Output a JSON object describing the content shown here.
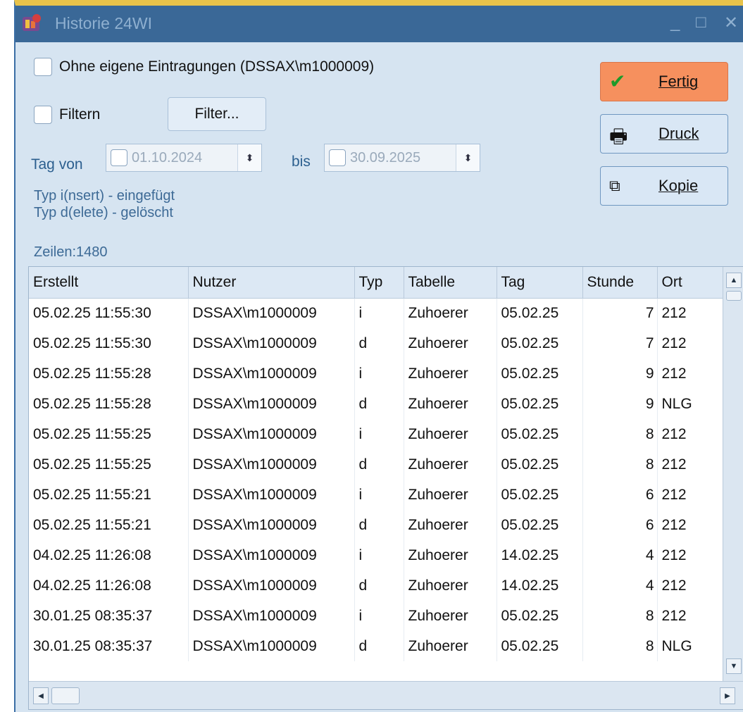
{
  "window": {
    "title": "Historie 24WI",
    "minimize": "_",
    "maximize": "□",
    "close": "✕"
  },
  "options": {
    "ohne_eigene_label": "Ohne eigene Eintragungen (DSSAX\\m1000009)",
    "filtern_label": "Filtern",
    "filter_button": "Filter..."
  },
  "date_range": {
    "von_label": "Tag von",
    "von_value": "01.10.2024",
    "bis_label": "bis",
    "bis_value": "30.09.2025"
  },
  "info": {
    "line1": "Typ i(nsert) - eingefügt",
    "line2": "Typ d(elete) - gelöscht",
    "rows": "Zeilen:1480"
  },
  "actions": {
    "fertig": "Fertig",
    "druck": "Druck",
    "kopie": "Kopie"
  },
  "icons": {
    "fertig": "check-icon",
    "druck": "printer-icon",
    "kopie": "copy-icon"
  },
  "colors": {
    "titlebar": "#3a6897",
    "primary_button": "#f6905e",
    "accent_text": "#2c5f8f"
  },
  "table": {
    "columns": [
      "Erstellt",
      "Nutzer",
      "Typ",
      "Tabelle",
      "Tag",
      "Stunde",
      "Ort"
    ],
    "rows": [
      [
        "05.02.25 11:55:30",
        "DSSAX\\m1000009",
        "i",
        "Zuhoerer",
        "05.02.25",
        "7",
        "212"
      ],
      [
        "05.02.25 11:55:30",
        "DSSAX\\m1000009",
        "d",
        "Zuhoerer",
        "05.02.25",
        "7",
        "212"
      ],
      [
        "05.02.25 11:55:28",
        "DSSAX\\m1000009",
        "i",
        "Zuhoerer",
        "05.02.25",
        "9",
        "212"
      ],
      [
        "05.02.25 11:55:28",
        "DSSAX\\m1000009",
        "d",
        "Zuhoerer",
        "05.02.25",
        "9",
        "NLG"
      ],
      [
        "05.02.25 11:55:25",
        "DSSAX\\m1000009",
        "i",
        "Zuhoerer",
        "05.02.25",
        "8",
        "212"
      ],
      [
        "05.02.25 11:55:25",
        "DSSAX\\m1000009",
        "d",
        "Zuhoerer",
        "05.02.25",
        "8",
        "212"
      ],
      [
        "05.02.25 11:55:21",
        "DSSAX\\m1000009",
        "i",
        "Zuhoerer",
        "05.02.25",
        "6",
        "212"
      ],
      [
        "05.02.25 11:55:21",
        "DSSAX\\m1000009",
        "d",
        "Zuhoerer",
        "05.02.25",
        "6",
        "212"
      ],
      [
        "04.02.25 11:26:08",
        "DSSAX\\m1000009",
        "i",
        "Zuhoerer",
        "14.02.25",
        "4",
        "212"
      ],
      [
        "04.02.25 11:26:08",
        "DSSAX\\m1000009",
        "d",
        "Zuhoerer",
        "14.02.25",
        "4",
        "212"
      ],
      [
        "30.01.25 08:35:37",
        "DSSAX\\m1000009",
        "i",
        "Zuhoerer",
        "05.02.25",
        "8",
        "212"
      ],
      [
        "30.01.25 08:35:37",
        "DSSAX\\m1000009",
        "d",
        "Zuhoerer",
        "05.02.25",
        "8",
        "NLG"
      ]
    ]
  }
}
